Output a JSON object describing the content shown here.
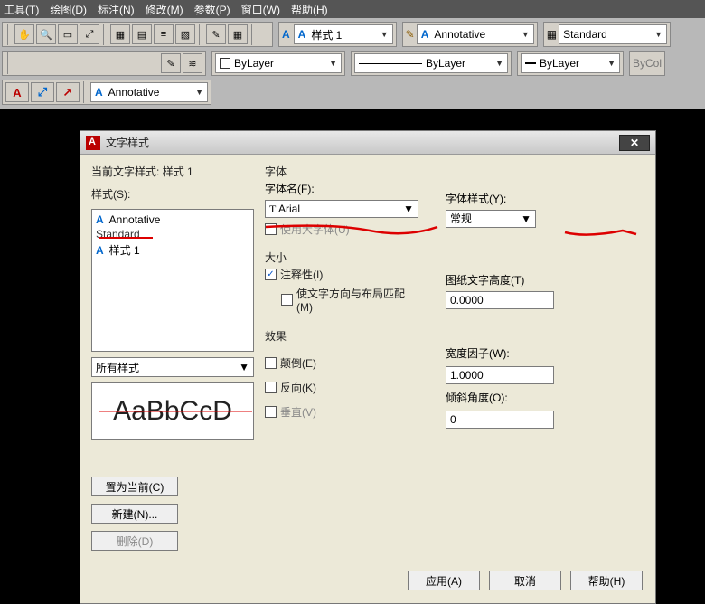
{
  "menu": {
    "tools": "工具(T)",
    "draw": "绘图(D)",
    "annotate": "标注(N)",
    "modify": "修改(M)",
    "params": "参数(P)",
    "window": "窗口(W)",
    "help": "帮助(H)"
  },
  "toolbar": {
    "text_style": "样式 1",
    "annotative": "Annotative",
    "standard": "Standard",
    "bylayer": "ByLayer",
    "bycolor": "ByCol"
  },
  "dialog": {
    "title": "文字样式",
    "current_label": "当前文字样式:",
    "current_value": "样式 1",
    "styles_label": "样式(S):",
    "list": {
      "annotative": "Annotative",
      "standard": "Standard",
      "style1": "样式 1"
    },
    "filter": "所有样式",
    "preview": "AaBbCcD",
    "font_group": "字体",
    "font_name_label": "字体名(F):",
    "font_name_value": "Arial",
    "font_style_label": "字体样式(Y):",
    "font_style_value": "常规",
    "use_bigfont": "使用大字体(U)",
    "size_group": "大小",
    "annot_chk": "注释性(I)",
    "match_orient": "使文字方向与布局匹配(M)",
    "paper_height_label": "图纸文字高度(T)",
    "paper_height_value": "0.0000",
    "effects_group": "效果",
    "upside": "颠倒(E)",
    "backwards": "反向(K)",
    "vertical": "垂直(V)",
    "width_label": "宽度因子(W):",
    "width_value": "1.0000",
    "oblique_label": "倾斜角度(O):",
    "oblique_value": "0",
    "btn_setcurrent": "置为当前(C)",
    "btn_new": "新建(N)...",
    "btn_delete": "删除(D)",
    "btn_apply": "应用(A)",
    "btn_cancel": "取消",
    "btn_help": "帮助(H)"
  }
}
